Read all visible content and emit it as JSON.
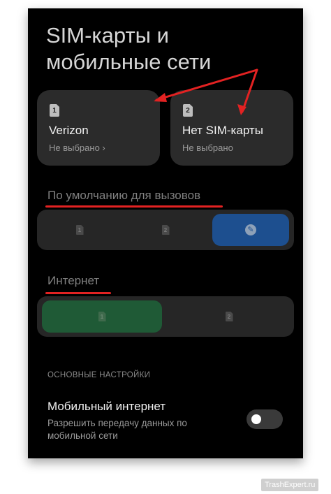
{
  "page": {
    "title": "SIM-карты и мобильные сети"
  },
  "sim_cards": [
    {
      "slot": "1",
      "name": "Verizon",
      "status": "Не выбрано ›"
    },
    {
      "slot": "2",
      "name": "Нет SIM-карты",
      "status": "Не выбрано"
    }
  ],
  "calls": {
    "label": "По умолчанию для вызовов",
    "options": [
      "1",
      "2",
      "ask"
    ],
    "selected": "ask"
  },
  "internet": {
    "label": "Интернет",
    "options": [
      "1",
      "2"
    ],
    "selected": "1"
  },
  "settings": {
    "group_label": "ОСНОВНЫЕ НАСТРОЙКИ",
    "mobile_data": {
      "title": "Мобильный интернет",
      "description": "Разрешить передачу данных по мобильной сети",
      "enabled": false
    }
  },
  "colors": {
    "background": "#000000",
    "card": "#2b2b2b",
    "call_selected": "#1d4f8f",
    "internet_selected": "#1f5a36",
    "annotation_red": "#e32222"
  },
  "watermark": "TrashExpert.ru"
}
